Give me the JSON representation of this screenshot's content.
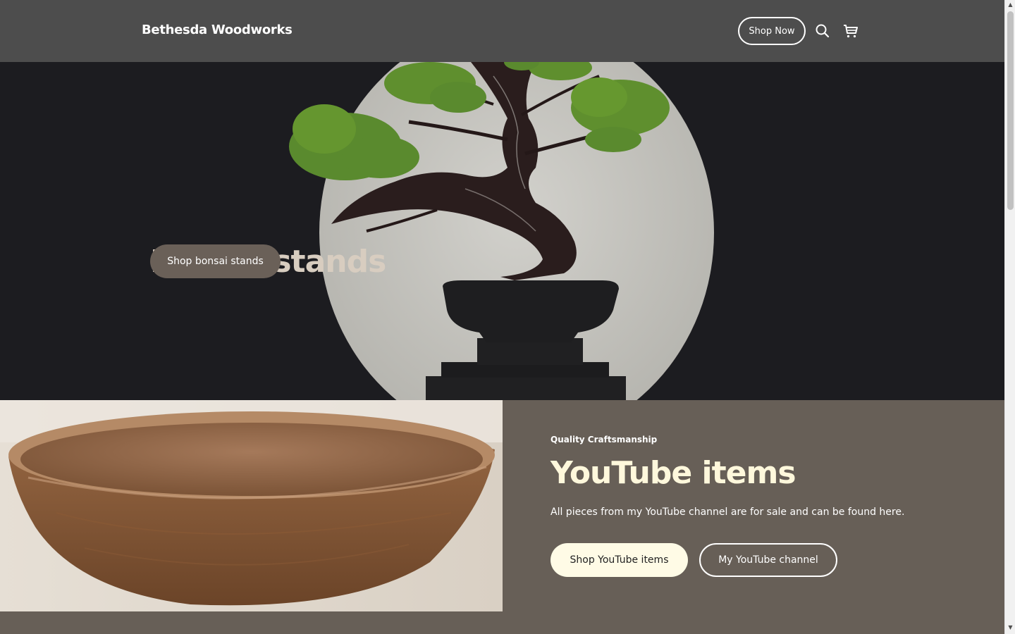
{
  "header": {
    "brand": "Bethesda Woodworks",
    "shop_now_label": "Shop Now",
    "icons": [
      "search-icon",
      "cart-icon"
    ]
  },
  "hero": {
    "title": "Bonsai stands",
    "button_label": "Shop bonsai stands",
    "image": "bonsai-tree-illustration"
  },
  "feature": {
    "image": "wooden-bowl-photo",
    "eyebrow": "Quality Craftsmanship",
    "title": "YouTube items",
    "description": "All pieces from my YouTube channel are for sale and can be found here.",
    "primary_button_label": "Shop YouTube items",
    "secondary_button_label": "My YouTube channel"
  },
  "colors": {
    "header_bg": "#4d4d4d",
    "hero_bg": "#1c1c20",
    "section_bg": "#675f57",
    "hero_title": "#d8cdc0",
    "feature_title": "#fff8dc",
    "primary_button_bg": "#fffbe6"
  }
}
